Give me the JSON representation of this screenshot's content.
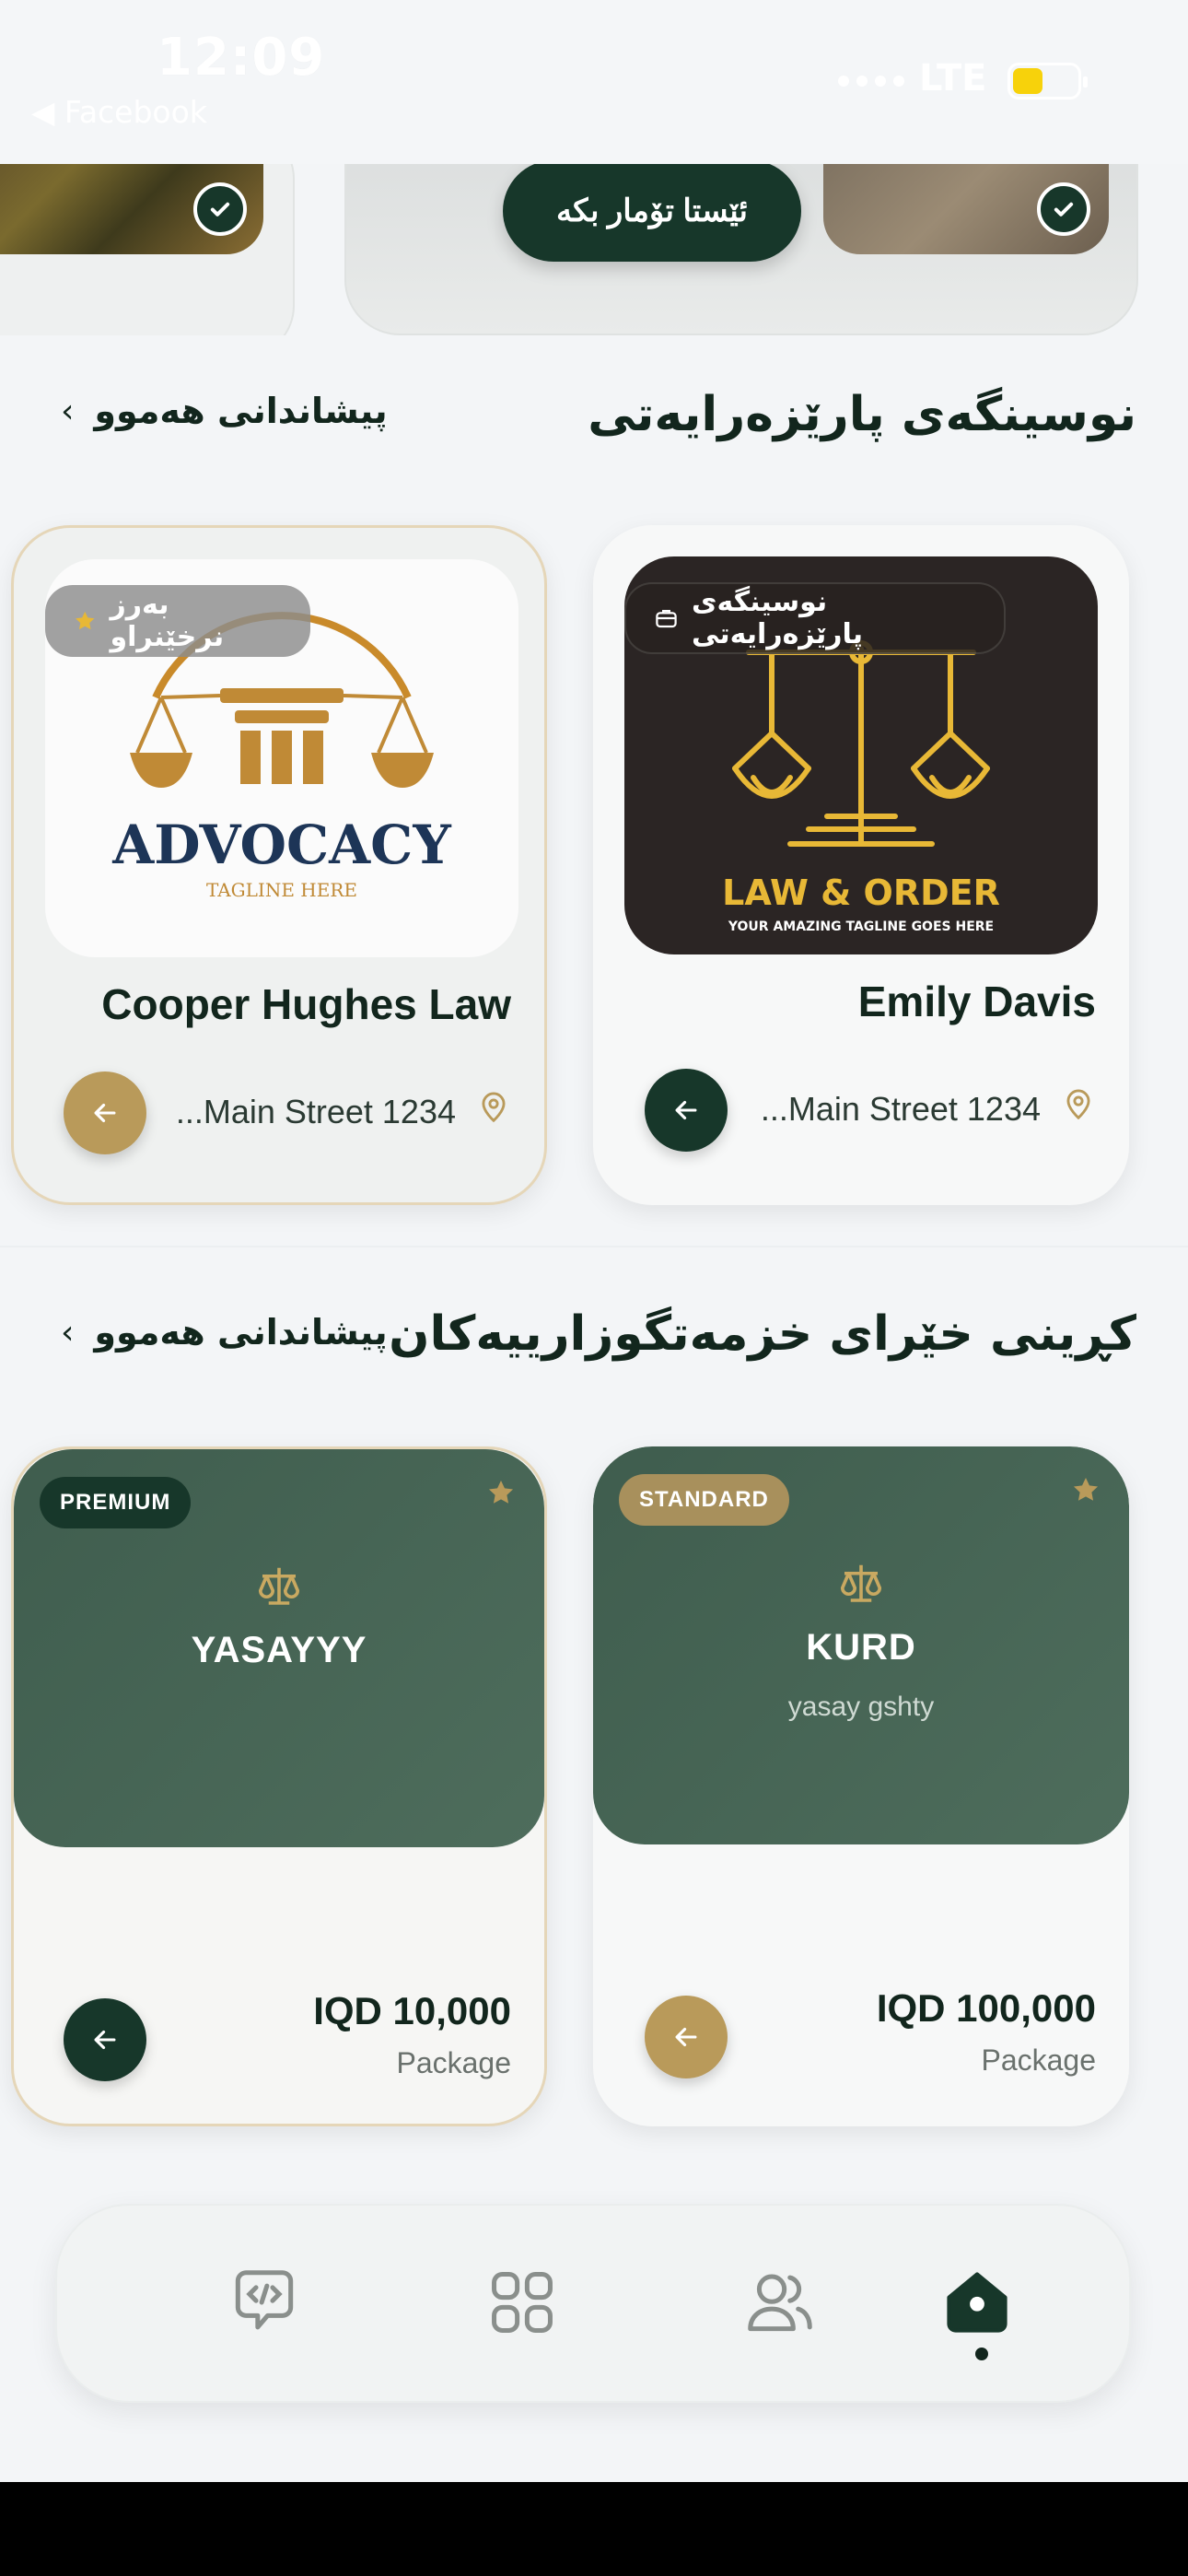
{
  "status_bar": {
    "time": "12:09",
    "back_app": "◀ Facebook",
    "network": "LTE"
  },
  "top_banner": {
    "register_button": "ئێستا تۆمار بکە"
  },
  "sections": {
    "offices": {
      "title": "نوسینگەی پارێزەرایەتی",
      "view_all": "پیشاندانی هەموو"
    },
    "packages": {
      "title": "کڕینی خێرای خزمەتگوزارییەکان",
      "view_all": "پیشاندانی هەموو"
    }
  },
  "offices": [
    {
      "name": "Emily Davis",
      "badge": "نوسینگەی پارێزەرایەتی",
      "address": "...Main Street 1234",
      "logo_title": "LAW & ORDER",
      "logo_tagline": "YOUR AMAZING TAGLINE GOES HERE"
    },
    {
      "name": "Cooper Hughes Law",
      "badge": "بەرز نرخێنراو",
      "address": "...Main Street 1234",
      "logo_title": "ADVOCACY",
      "logo_tagline": "TAGLINE HERE"
    }
  ],
  "packages": [
    {
      "tier": "STANDARD",
      "name": "KURD",
      "subtitle": "yasay gshty",
      "price": "IQD 100,000",
      "label": "Package"
    },
    {
      "tier": "PREMIUM",
      "name": "YASAYYY",
      "subtitle": "",
      "price": "IQD 10,000",
      "label": "Package"
    }
  ],
  "bottom_nav": {
    "items": [
      "home-icon",
      "users-icon",
      "grid-icon",
      "chat-code-icon"
    ],
    "active": "home-icon"
  },
  "colors": {
    "primary_dark": "#17372a",
    "gold": "#b99a5a",
    "package_green": "#46634f",
    "background": "#f3f5f7"
  }
}
